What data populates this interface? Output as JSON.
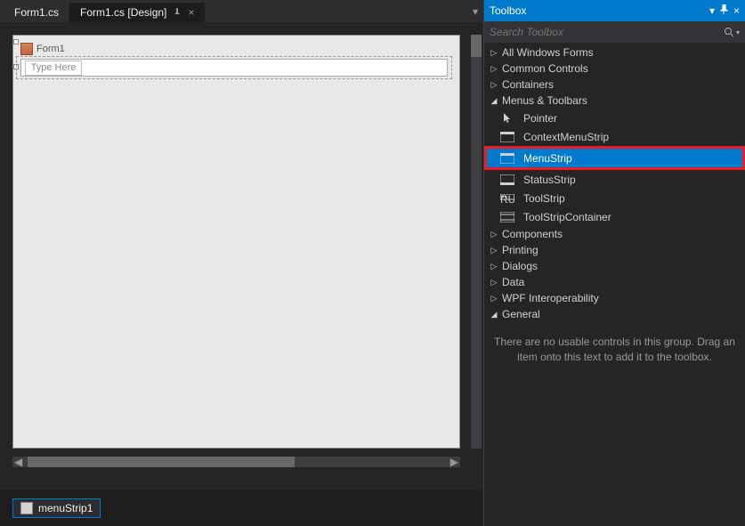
{
  "tabs": [
    {
      "label": "Form1.cs",
      "active": false
    },
    {
      "label": "Form1.cs [Design]",
      "active": true
    }
  ],
  "form": {
    "title": "Form1",
    "type_here": "Type Here"
  },
  "tray": {
    "item": "menuStrip1"
  },
  "toolbox": {
    "title": "Toolbox",
    "search_placeholder": "Search Toolbox",
    "groups": [
      {
        "label": "All Windows Forms",
        "expanded": false
      },
      {
        "label": "Common Controls",
        "expanded": false
      },
      {
        "label": "Containers",
        "expanded": false
      },
      {
        "label": "Menus & Toolbars",
        "expanded": true,
        "items": [
          {
            "label": "Pointer",
            "icon": "pointer"
          },
          {
            "label": "ContextMenuStrip",
            "icon": "menu"
          },
          {
            "label": "MenuStrip",
            "icon": "menu",
            "selected": true
          },
          {
            "label": "StatusStrip",
            "icon": "status"
          },
          {
            "label": "ToolStrip",
            "icon": "tool"
          },
          {
            "label": "ToolStripContainer",
            "icon": "container"
          }
        ]
      },
      {
        "label": "Components",
        "expanded": false
      },
      {
        "label": "Printing",
        "expanded": false
      },
      {
        "label": "Dialogs",
        "expanded": false
      },
      {
        "label": "Data",
        "expanded": false
      },
      {
        "label": "WPF Interoperability",
        "expanded": false
      },
      {
        "label": "General",
        "expanded": true,
        "empty": true
      }
    ],
    "empty_text": "There are no usable controls in this group. Drag an item onto this text to add it to the toolbox."
  }
}
